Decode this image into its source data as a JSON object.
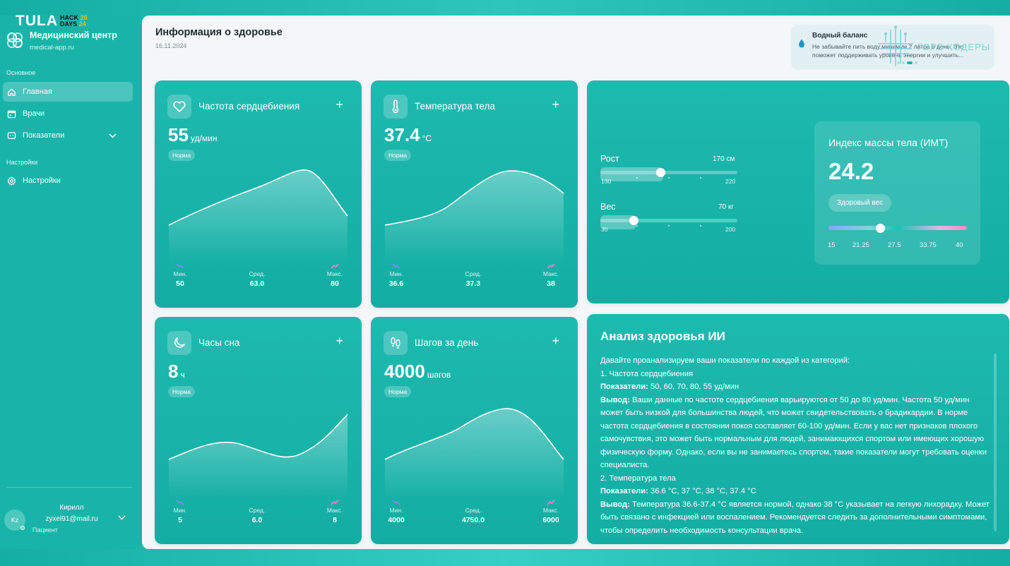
{
  "overlay": {
    "hackathon": {
      "tula": "TULA",
      "hack": "HACK",
      "year_top": "20",
      "days": "DAYS",
      "year_bottom": "24"
    },
    "team": "ГОРЕ КОДЕРЫ"
  },
  "sidebar": {
    "brand_name": "Медицинский центр",
    "brand_url": "medical-app.ru",
    "section_main": "Основное",
    "section_settings": "Настройки",
    "items": [
      {
        "label": "Главная",
        "icon": "home-icon"
      },
      {
        "label": "Врачи",
        "icon": "calendar-icon"
      },
      {
        "label": "Показатели",
        "icon": "chat-icon"
      },
      {
        "label": "Настройки",
        "icon": "gear-icon"
      }
    ],
    "user": {
      "initials": "Kz",
      "name": "Кирилл",
      "email": "zyxel91@mail.ru",
      "role": "Пациент"
    }
  },
  "header": {
    "title": "Информация о здоровье",
    "date": "16.11.2024"
  },
  "tip": {
    "title": "Водный баланс",
    "text": "Не забывайте пить воду минимум 2 литра в день. Это поможет поддерживать уровень энергии и улучшить..."
  },
  "metrics": [
    {
      "title": "Частота сердцебиения",
      "value": "55",
      "unit": "уд/мин",
      "status": "Норма",
      "icon": "heart-icon",
      "min_label": "Мин.",
      "avg_label": "Сред.",
      "max_label": "Макс.",
      "min": "50",
      "avg": "63.0",
      "max": "80"
    },
    {
      "title": "Температура тела",
      "value": "37.4",
      "unit": "°C",
      "status": "Норма",
      "icon": "thermometer-icon",
      "min_label": "Мин.",
      "avg_label": "Сред.",
      "max_label": "Макс.",
      "min": "36.6",
      "avg": "37.3",
      "max": "38"
    },
    {
      "title": "Часы сна",
      "value": "8",
      "unit": "ч",
      "status": "Норма",
      "icon": "moon-icon",
      "min_label": "Мин.",
      "avg_label": "Сред.",
      "max_label": "Макс.",
      "min": "5",
      "avg": "6.0",
      "max": "8"
    },
    {
      "title": "Шагов за день",
      "value": "4000",
      "unit": "шагов",
      "status": "Норма",
      "icon": "footprints-icon",
      "min_label": "Мин.",
      "avg_label": "Сред.",
      "max_label": "Макс.",
      "min": "4000",
      "avg": "4750.0",
      "max": "6000"
    }
  ],
  "body": {
    "height": {
      "label": "Рост",
      "value": "170 см",
      "min": "130",
      "max": "220",
      "fraction": 0.44
    },
    "weight": {
      "label": "Вес",
      "value": "70 кг",
      "min": "30",
      "max": "200",
      "fraction": 0.24
    }
  },
  "bmi": {
    "title": "Индекс массы тела (ИМТ)",
    "value": "24.2",
    "status": "Здоровый вес",
    "scale": [
      "15",
      "21.25",
      "27.5",
      "33.75",
      "40"
    ],
    "fraction": 0.37
  },
  "ai": {
    "title": "Анализ здоровья ИИ",
    "intro": "Давайте проанализируем ваши показатели по каждой из категорий:",
    "h1": "1. Частота сердцебиения",
    "ind_label": "Показатели:",
    "h1_ind": " 50, 60, 70, 80, 55 уд/мин",
    "out_label": "Вывод:",
    "h1_out": " Ваши данные по частоте сердцебиения варьируются от 50 до 80 уд/мин. Частота 50 уд/мин может быть низкой для большинства людей, что может свидетельствовать о брадикардии. В норме частота сердцебиения в состоянии покоя составляет 60-100 уд/мин. Если у вас нет признаков плохого самочувствия, это может быть нормальным для людей, занимающихся спортом или имеющих хорошую физическую форму. Однако, если вы не занимаетесь спортом, такие показатели могут требовать оценки специалиста.",
    "h2": "2. Температура тела",
    "h2_ind": " 36.6 °C, 37 °C, 38 °C, 37.4 °C",
    "h2_out": " Температура 36.6-37.4 °C является нормой, однако 38 °C указывает на легкую лихорадку. Может быть связано с инфекцией или воспалением. Рекомендуется следить за дополнительными симптомами, чтобы определить необходимость консультации врача."
  }
}
